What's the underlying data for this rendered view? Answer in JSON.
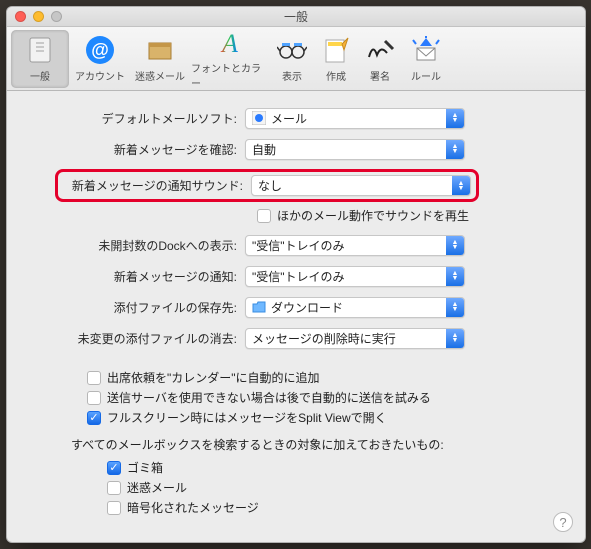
{
  "window": {
    "title": "一般"
  },
  "toolbar": {
    "items": [
      {
        "label": "一般"
      },
      {
        "label": "アカウント"
      },
      {
        "label": "迷惑メール"
      },
      {
        "label": "フォントとカラー"
      },
      {
        "label": "表示"
      },
      {
        "label": "作成"
      },
      {
        "label": "署名"
      },
      {
        "label": "ルール"
      }
    ]
  },
  "rows": {
    "default_app": {
      "label": "デフォルトメールソフト:",
      "value": "メール"
    },
    "check_new": {
      "label": "新着メッセージを確認:",
      "value": "自動"
    },
    "sound": {
      "label": "新着メッセージの通知サウンド:",
      "value": "なし"
    },
    "sound_sub": "ほかのメール動作でサウンドを再生",
    "dock": {
      "label": "未開封数のDockへの表示:",
      "value": "\"受信\"トレイのみ"
    },
    "notify": {
      "label": "新着メッセージの通知:",
      "value": "\"受信\"トレイのみ"
    },
    "save": {
      "label": "添付ファイルの保存先:",
      "value": "ダウンロード"
    },
    "purge": {
      "label": "未変更の添付ファイルの消去:",
      "value": "メッセージの削除時に実行"
    }
  },
  "checks": {
    "cal": "出席依頼を\"カレンダー\"に自動的に追加",
    "retry": "送信サーバを使用できない場合は後で自動的に送信を試みる",
    "split": "フルスクリーン時にはメッセージをSplit Viewで開く"
  },
  "search": {
    "heading": "すべてのメールボックスを検索するときの対象に加えておきたいもの:",
    "trash": "ゴミ箱",
    "junk": "迷惑メール",
    "enc": "暗号化されたメッセージ"
  }
}
